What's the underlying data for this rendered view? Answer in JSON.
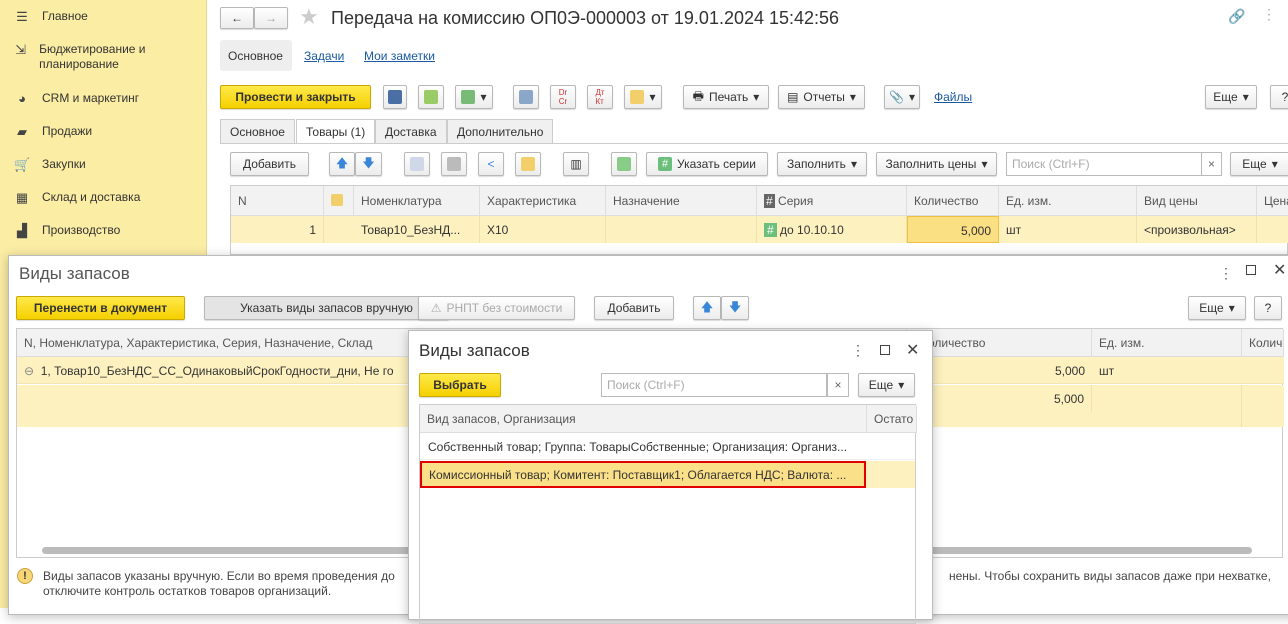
{
  "sidebar": {
    "items": [
      {
        "label": "Главное",
        "icon": "menu-icon"
      },
      {
        "label": "Бюджетирование и планирование",
        "icon": "budget-icon"
      },
      {
        "label": "CRM и маркетинг",
        "icon": "pie-icon"
      },
      {
        "label": "Продажи",
        "icon": "bag-icon"
      },
      {
        "label": "Закупки",
        "icon": "cart-icon"
      },
      {
        "label": "Склад и доставка",
        "icon": "warehouse-icon"
      },
      {
        "label": "Производство",
        "icon": "factory-icon"
      }
    ]
  },
  "doc": {
    "title": "Передача на комиссию ОП0Э-000003 от 19.01.2024 15:42:56",
    "nav_tabs": [
      "Основное",
      "Задачи",
      "Мои заметки"
    ],
    "post_close": "Провести и закрыть",
    "print": "Печать",
    "reports": "Отчеты",
    "files": "Файлы",
    "more": "Еще",
    "help": "?",
    "tabs": [
      "Основное",
      "Товары (1)",
      "Доставка",
      "Дополнительно"
    ],
    "add": "Добавить",
    "specify_series": "Указать серии",
    "fill": "Заполнить",
    "fill_prices": "Заполнить цены",
    "search_placeholder": "Поиск (Ctrl+F)",
    "clear": "×",
    "columns": [
      "N",
      "",
      "Номенклатура",
      "Характеристика",
      "Назначение",
      "Серия",
      "Количество",
      "Ед. изм.",
      "Вид цены",
      "Цена"
    ],
    "row": {
      "n": "1",
      "nomenclature": "Товар10_БезНД...",
      "characteristic": "X10",
      "purpose": "",
      "series": "до 10.10.10",
      "qty": "5,000",
      "unit": "шт",
      "price_kind": "<произвольная>"
    }
  },
  "stock_dialog": {
    "title": "Виды запасов",
    "transfer": "Перенести в документ",
    "manual": "Указать виды запасов вручную",
    "rnpt": "РНПТ без стоимости",
    "add": "Добавить",
    "more": "Еще",
    "help": "?",
    "columns": [
      "N, Номенклатура, Характеристика, Серия, Назначение, Склад",
      "Количество",
      "Ед. изм.",
      "Колич"
    ],
    "rows": [
      {
        "text": "1, Товар10_БезНДС_СС_ОдинаковыйСрокГодности_дни, Не го",
        "qty": "5,000",
        "unit": "шт"
      },
      {
        "text": "",
        "qty": "5,000",
        "unit": ""
      }
    ],
    "warning_line1": "Виды запасов указаны вручную. Если во время проведения до",
    "warning_line1_end": "нены. Чтобы сохранить виды запасов даже при нехватке,",
    "warning_line2": "отключите контроль остатков товаров организаций."
  },
  "select_dialog": {
    "title": "Виды запасов",
    "select": "Выбрать",
    "search_placeholder": "Поиск (Ctrl+F)",
    "clear": "×",
    "more": "Еще",
    "columns": [
      "Вид запасов, Организация",
      "Остато"
    ],
    "rows": [
      "Собственный товар; Группа: ТоварыСобственные; Организация: Организ...",
      "Комиссионный товар; Комитент: Поставщик1; Облагается НДС; Валюта: ..."
    ],
    "highlight_color": "#e00000"
  }
}
